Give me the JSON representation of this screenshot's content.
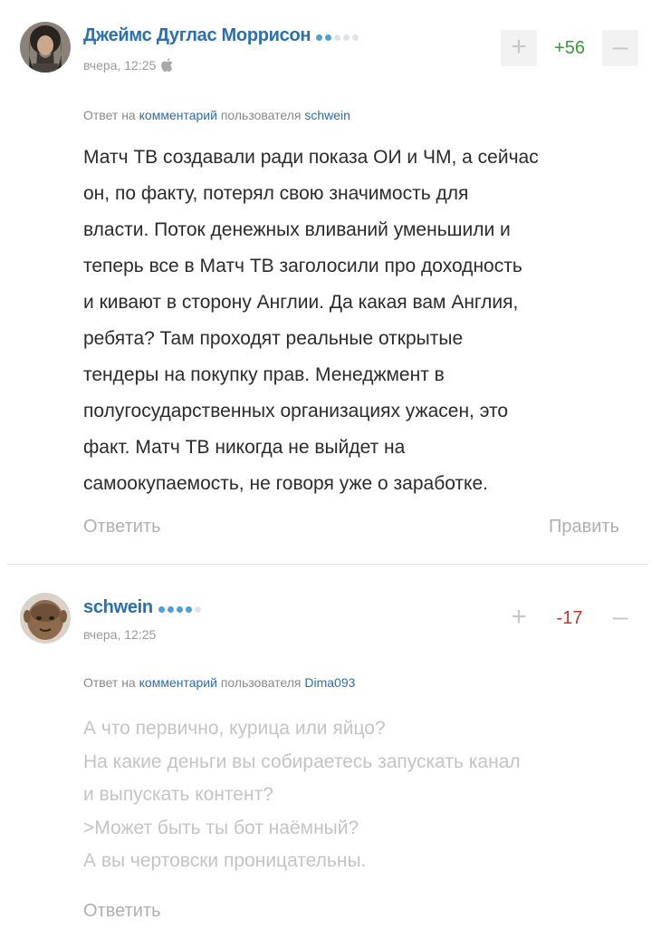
{
  "comments": [
    {
      "author": "Джеймс Дуглас Моррисон",
      "rating_dots": 5,
      "rating_filled": 2,
      "date": "вчера, 12:25",
      "device_icon": "apple-icon",
      "score": "+56",
      "reply_prefix": "Ответ на",
      "reply_link": "комментарий",
      "reply_mid": "пользователя",
      "reply_user": "schwein",
      "text_lines": [
        "Матч ТВ создавали ради показа ОИ и ЧМ, а сейчас",
        "он, по факту, потерял свою значимость для",
        "власти. Поток денежных вливаний уменьшили и",
        "теперь все в Матч ТВ заголосили про доходность",
        "и кивают в сторону Англии. Да какая вам Англия,",
        "ребята? Там проходят реальные открытые",
        "тендеры на покупку прав. Менеджмент в",
        "полугосударственных организациях ужасен, это",
        "факт. Матч ТВ никогда не выйдет на",
        "самоокупаемость, не говоря уже о заработке."
      ],
      "reply_label": "Ответить",
      "edit_label": "Править"
    },
    {
      "author": "schwein",
      "rating_dots": 5,
      "rating_filled": 4,
      "date": "вчера, 12:25",
      "score": "-17",
      "reply_prefix": "Ответ на",
      "reply_link": "комментарий",
      "reply_mid": "пользователя",
      "reply_user": "Dima093",
      "text_lines": [
        "А что первично, курица или яйцо?",
        "На какие деньги вы собираетесь запускать канал",
        "и выпускать контент?",
        ">Может быть ты бот наёмный?",
        "А вы чертовски проницательны."
      ],
      "reply_label": "Ответить"
    }
  ],
  "colors": {
    "link": "#2a6fae",
    "score_positive": "#3a9a3a",
    "score_negative": "#c0362c",
    "rating_dot_on": "#4aa0dc"
  }
}
